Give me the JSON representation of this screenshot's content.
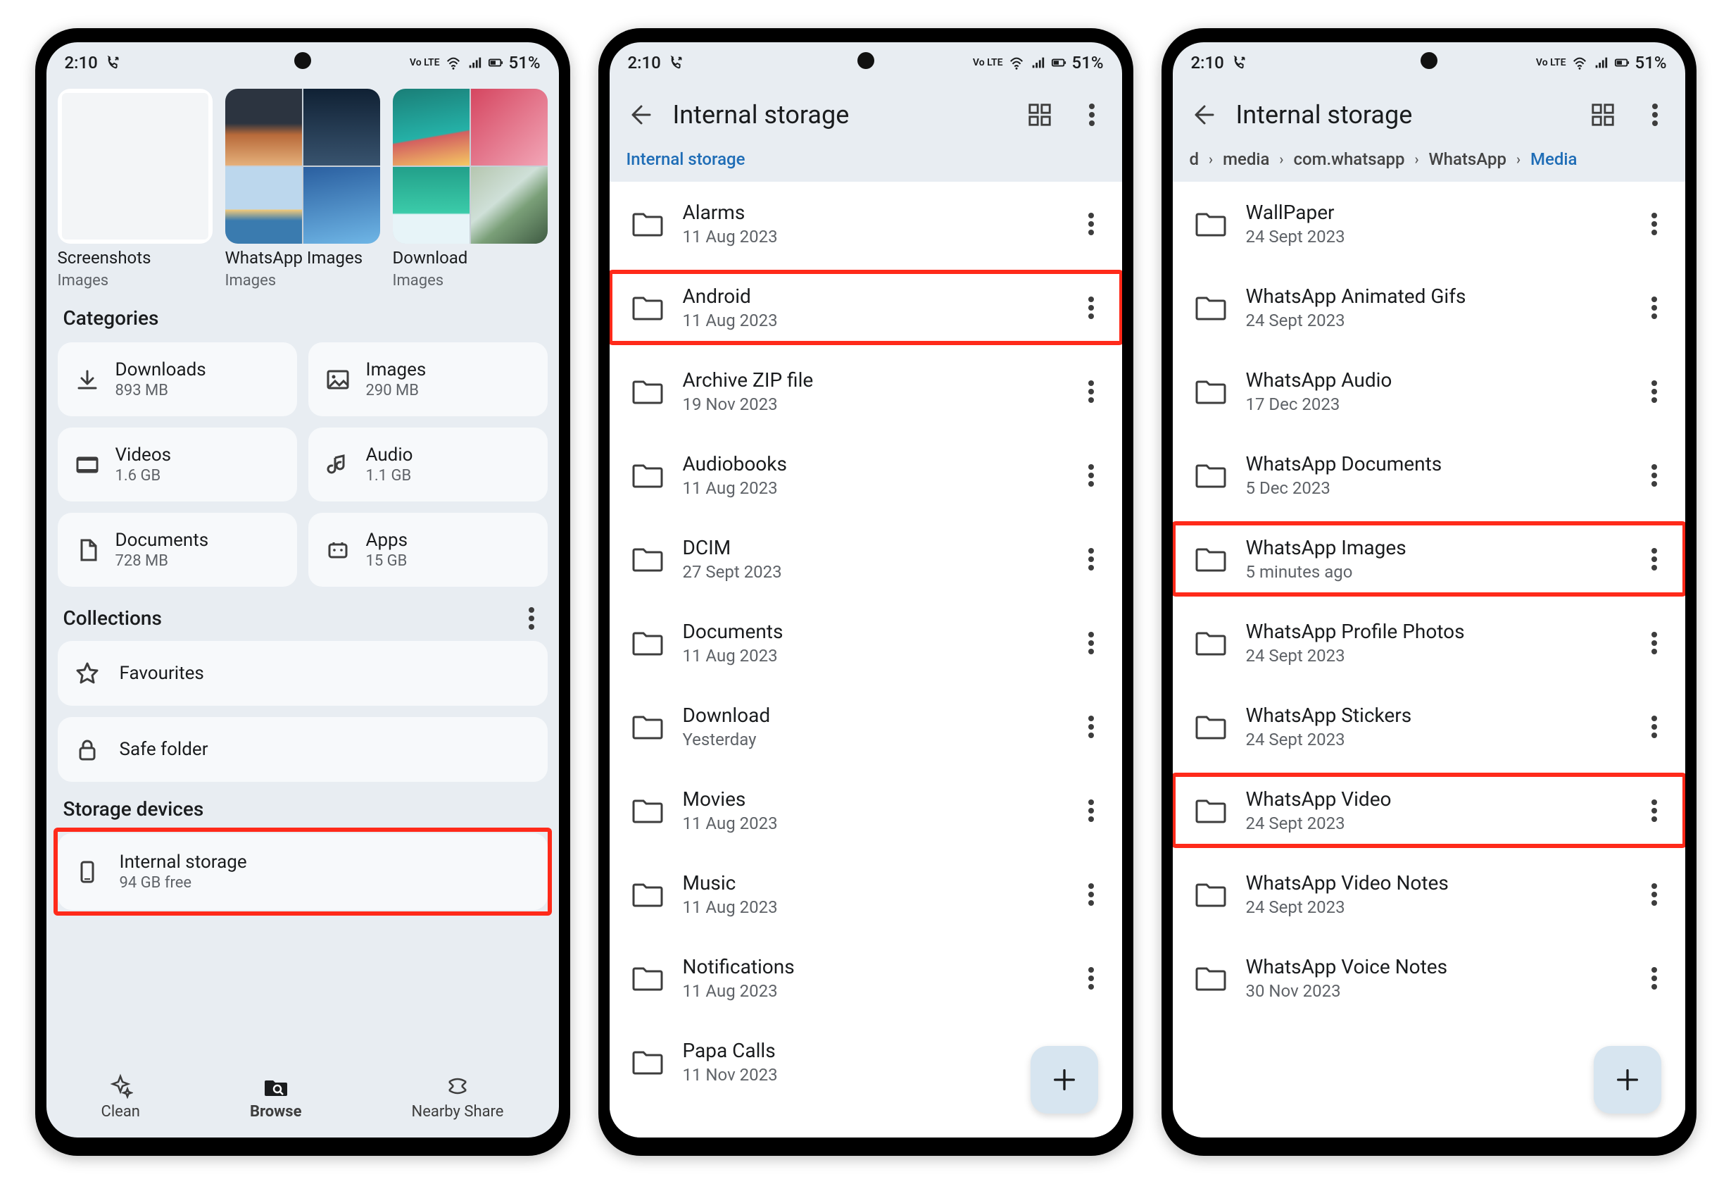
{
  "status": {
    "time": "2:10",
    "lte": "Vo LTE",
    "battery": "51%"
  },
  "panel1": {
    "thumbs": [
      {
        "label": "Screenshots",
        "sub": "Images"
      },
      {
        "label": "WhatsApp Images",
        "sub": "Images"
      },
      {
        "label": "Download",
        "sub": "Images"
      }
    ],
    "categoriesTitle": "Categories",
    "categories": [
      {
        "name": "Downloads",
        "sub": "893 MB"
      },
      {
        "name": "Images",
        "sub": "290 MB"
      },
      {
        "name": "Videos",
        "sub": "1.6 GB"
      },
      {
        "name": "Audio",
        "sub": "1.1 GB"
      },
      {
        "name": "Documents",
        "sub": "728 MB"
      },
      {
        "name": "Apps",
        "sub": "15 GB"
      }
    ],
    "collectionsTitle": "Collections",
    "collections": [
      {
        "name": "Favourites"
      },
      {
        "name": "Safe folder"
      }
    ],
    "storageTitle": "Storage devices",
    "storage": {
      "name": "Internal storage",
      "sub": "94 GB free"
    },
    "nav": {
      "clean": "Clean",
      "browse": "Browse",
      "share": "Nearby Share"
    }
  },
  "panel2": {
    "title": "Internal storage",
    "breadcrumb": "Internal storage",
    "folders": [
      {
        "name": "Alarms",
        "date": "11 Aug 2023"
      },
      {
        "name": "Android",
        "date": "11 Aug 2023"
      },
      {
        "name": "Archive ZIP file",
        "date": "19 Nov 2023"
      },
      {
        "name": "Audiobooks",
        "date": "11 Aug 2023"
      },
      {
        "name": "DCIM",
        "date": "27 Sept 2023"
      },
      {
        "name": "Documents",
        "date": "11 Aug 2023"
      },
      {
        "name": "Download",
        "date": "Yesterday"
      },
      {
        "name": "Movies",
        "date": "11 Aug 2023"
      },
      {
        "name": "Music",
        "date": "11 Aug 2023"
      },
      {
        "name": "Notifications",
        "date": "11 Aug 2023"
      },
      {
        "name": "Papa Calls",
        "date": "11 Nov 2023"
      }
    ]
  },
  "panel3": {
    "title": "Internal storage",
    "crumbs": [
      "d",
      "media",
      "com.whatsapp",
      "WhatsApp",
      "Media"
    ],
    "folders": [
      {
        "name": "WallPaper",
        "date": "24 Sept 2023"
      },
      {
        "name": "WhatsApp Animated Gifs",
        "date": "24 Sept 2023"
      },
      {
        "name": "WhatsApp Audio",
        "date": "17 Dec 2023"
      },
      {
        "name": "WhatsApp Documents",
        "date": "5 Dec 2023"
      },
      {
        "name": "WhatsApp Images",
        "date": "5 minutes ago"
      },
      {
        "name": "WhatsApp Profile Photos",
        "date": "24 Sept 2023"
      },
      {
        "name": "WhatsApp Stickers",
        "date": "24 Sept 2023"
      },
      {
        "name": "WhatsApp Video",
        "date": "24 Sept 2023"
      },
      {
        "name": "WhatsApp Video Notes",
        "date": "24 Sept 2023"
      },
      {
        "name": "WhatsApp Voice Notes",
        "date": "30 Nov 2023"
      }
    ]
  }
}
